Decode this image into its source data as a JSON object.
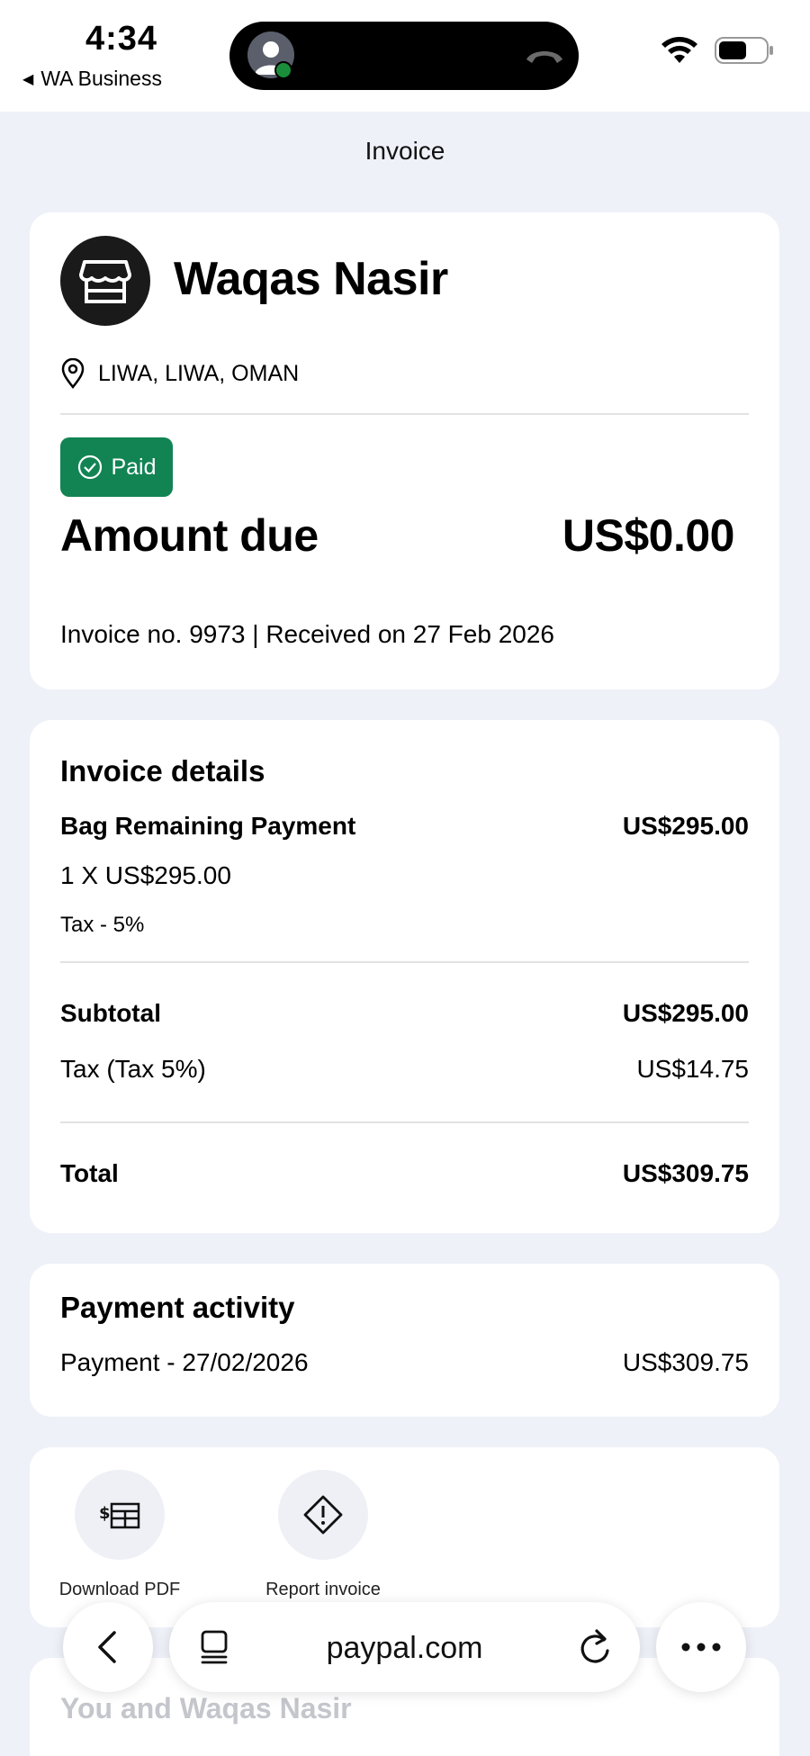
{
  "status_bar": {
    "time": "4:34",
    "back_app": "WA Business"
  },
  "page": {
    "title": "Invoice"
  },
  "merchant": {
    "name": "Waqas Nasir",
    "location": "LIWA, LIWA, OMAN"
  },
  "summary": {
    "status_badge": "Paid",
    "amount_due_label": "Amount due",
    "amount_due_value": "US$0.00",
    "invoice_info": "Invoice no. 9973 | Received on 27 Feb 2026"
  },
  "details": {
    "heading": "Invoice details",
    "item": {
      "name": "Bag Remaining Payment",
      "amount": "US$295.00",
      "quantity_line": "1 X US$295.00",
      "tax_line": "Tax - 5%"
    },
    "subtotal": {
      "label": "Subtotal",
      "value": "US$295.00"
    },
    "tax": {
      "label": "Tax (Tax 5%)",
      "value": "US$14.75"
    },
    "total": {
      "label": "Total",
      "value": "US$309.75"
    }
  },
  "payment_activity": {
    "heading": "Payment activity",
    "entries": [
      {
        "label": "Payment - 27/02/2026",
        "value": "US$309.75"
      }
    ]
  },
  "actions": {
    "download_pdf": "Download PDF",
    "report_invoice": "Report invoice"
  },
  "next_section": {
    "title": "You and Waqas Nasir"
  },
  "browser": {
    "url": "paypal.com"
  }
}
